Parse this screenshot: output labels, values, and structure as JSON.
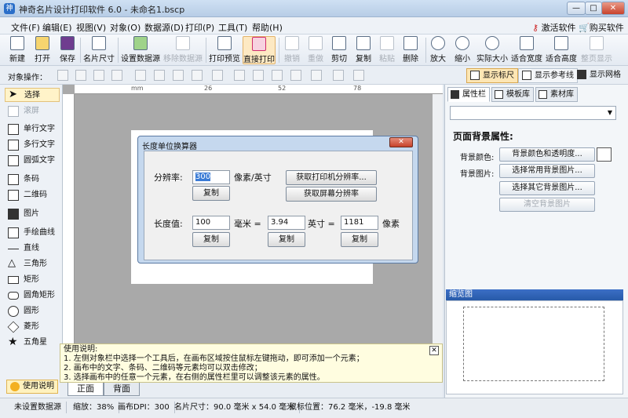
{
  "window": {
    "title": "神奇名片设计打印软件 6.0 - 未命名1.bscp",
    "app_icon": "神",
    "min": "—",
    "max": "□",
    "close": "✕"
  },
  "menu": [
    "文件(F)",
    "编辑(E)",
    "视图(V)",
    "对象(O)",
    "数据源(D)",
    "打印(P)",
    "工具(T)",
    "帮助(H)"
  ],
  "menu_right": {
    "activate": "激活软件",
    "buy": "购买软件"
  },
  "toolbar": [
    {
      "label": "新建",
      "icon": "new-file-icon"
    },
    {
      "label": "打开",
      "icon": "open-folder-icon"
    },
    {
      "label": "保存",
      "icon": "save-icon"
    },
    {
      "label": "名片尺寸",
      "icon": "card-size-icon"
    },
    {
      "label": "设置数据源",
      "icon": "database-icon"
    },
    {
      "label": "移除数据源",
      "icon": "remove-database-icon"
    },
    {
      "label": "打印预览",
      "icon": "print-preview-icon"
    },
    {
      "label": "直接打印",
      "icon": "printer-icon"
    },
    {
      "label": "撤销",
      "icon": "undo-icon"
    },
    {
      "label": "重做",
      "icon": "redo-icon"
    },
    {
      "label": "剪切",
      "icon": "cut-icon"
    },
    {
      "label": "复制",
      "icon": "copy-icon"
    },
    {
      "label": "粘贴",
      "icon": "paste-icon"
    },
    {
      "label": "删除",
      "icon": "delete-icon"
    },
    {
      "label": "放大",
      "icon": "zoom-in-icon"
    },
    {
      "label": "缩小",
      "icon": "zoom-out-icon"
    },
    {
      "label": "实际大小",
      "icon": "actual-size-icon"
    },
    {
      "label": "适合宽度",
      "icon": "fit-width-icon"
    },
    {
      "label": "适合高度",
      "icon": "fit-height-icon"
    },
    {
      "label": "整页显示",
      "icon": "full-page-icon"
    }
  ],
  "objbar": {
    "label": "对象操作：",
    "show_ruler": "显示标尺",
    "show_guides": "显示参考线",
    "show_grid": "显示网格"
  },
  "tools": [
    {
      "label": "选择",
      "icon": "pointer-icon"
    },
    {
      "label": "滚屏",
      "icon": "hand-icon"
    },
    {
      "label": "单行文字",
      "icon": "single-line-text-icon"
    },
    {
      "label": "多行文字",
      "icon": "multi-line-text-icon"
    },
    {
      "label": "圆弧文字",
      "icon": "arc-text-icon"
    },
    {
      "label": "条码",
      "icon": "barcode-icon"
    },
    {
      "label": "二维码",
      "icon": "qrcode-icon"
    },
    {
      "label": "图片",
      "icon": "image-icon"
    },
    {
      "label": "手绘曲线",
      "icon": "freehand-icon"
    },
    {
      "label": "直线",
      "icon": "line-icon"
    },
    {
      "label": "三角形",
      "icon": "triangle-icon"
    },
    {
      "label": "矩形",
      "icon": "rectangle-icon"
    },
    {
      "label": "圆角矩形",
      "icon": "rounded-rectangle-icon"
    },
    {
      "label": "圆形",
      "icon": "circle-icon"
    },
    {
      "label": "菱形",
      "icon": "diamond-icon"
    },
    {
      "label": "五角星",
      "icon": "star-icon"
    }
  ],
  "help_button": "使用说明",
  "ruler": {
    "marks": [
      "mm",
      "26",
      "52",
      "78"
    ]
  },
  "help_text": {
    "title": "使用说明:",
    "line1": "1. 左侧对象栏中选择一个工具后，在画布区域按住鼠标左键拖动，即可添加一个元素；",
    "line2": "2. 画布中的文字、条码、二维码等元素均可以双击修改；",
    "line3": "3. 选择画布中的任意一个元素，在右侧的属性栏里可以调整该元素的属性。"
  },
  "page_tabs": {
    "front": "正面",
    "back": "背面"
  },
  "right_panel": {
    "tabs": [
      "属性栏",
      "模板库",
      "素材库"
    ],
    "combo_value": "",
    "heading": "页面背景属性:",
    "bg_color_label": "背景颜色:",
    "bg_image_label": "背景图片:",
    "btn_color": "背景颜色和透明度...",
    "btn_common_img": "选择常用背景图片...",
    "btn_other_img": "选择其它背景图片...",
    "btn_clear_img": "清空背景图片",
    "preview_title": "缩览图"
  },
  "dialog": {
    "title": "长度单位换算器",
    "close": "✕",
    "res_label": "分辨率:",
    "res_value": "300",
    "res_unit": "像素/英寸",
    "copy": "复制",
    "btn_printer_res": "获取打印机分辨率...",
    "btn_screen_res": "获取屏幕分辨率",
    "len_label": "长度值:",
    "mm_value": "100",
    "mm_unit": "毫米 =",
    "inch_value": "3.94",
    "inch_unit": "英寸 =",
    "px_value": "1181",
    "px_unit": "像素"
  },
  "status": {
    "datasource": "未设置数据源",
    "zoom": "缩放：38%",
    "dpi": "画布DPI：300",
    "card_size": "名片尺寸：90.0 毫米 x 54.0 毫米",
    "mouse": "鼠标位置：76.2 毫米，-19.8 毫米"
  }
}
